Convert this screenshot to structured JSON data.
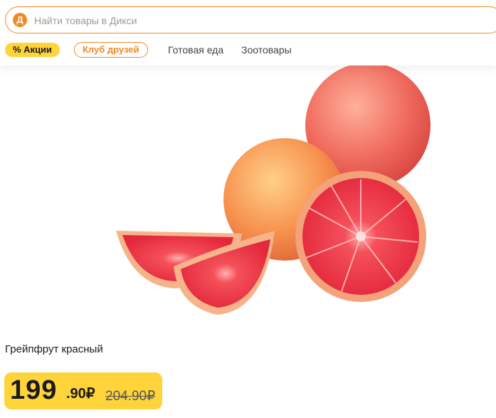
{
  "search": {
    "logo_letter": "Д",
    "placeholder": "Найти товары в Дикси"
  },
  "nav": {
    "promo": "% Акции",
    "club": "Клуб друзей",
    "links": [
      "Готовая еда",
      "Зоотовары"
    ]
  },
  "product": {
    "image": "grapefruit-image",
    "name": "Грейпфрут красный",
    "price_int": "199",
    "price_frac": ".90₽",
    "old_price": "204.90₽"
  },
  "colors": {
    "accent": "#f08a24",
    "price_bg": "#ffd43b"
  }
}
